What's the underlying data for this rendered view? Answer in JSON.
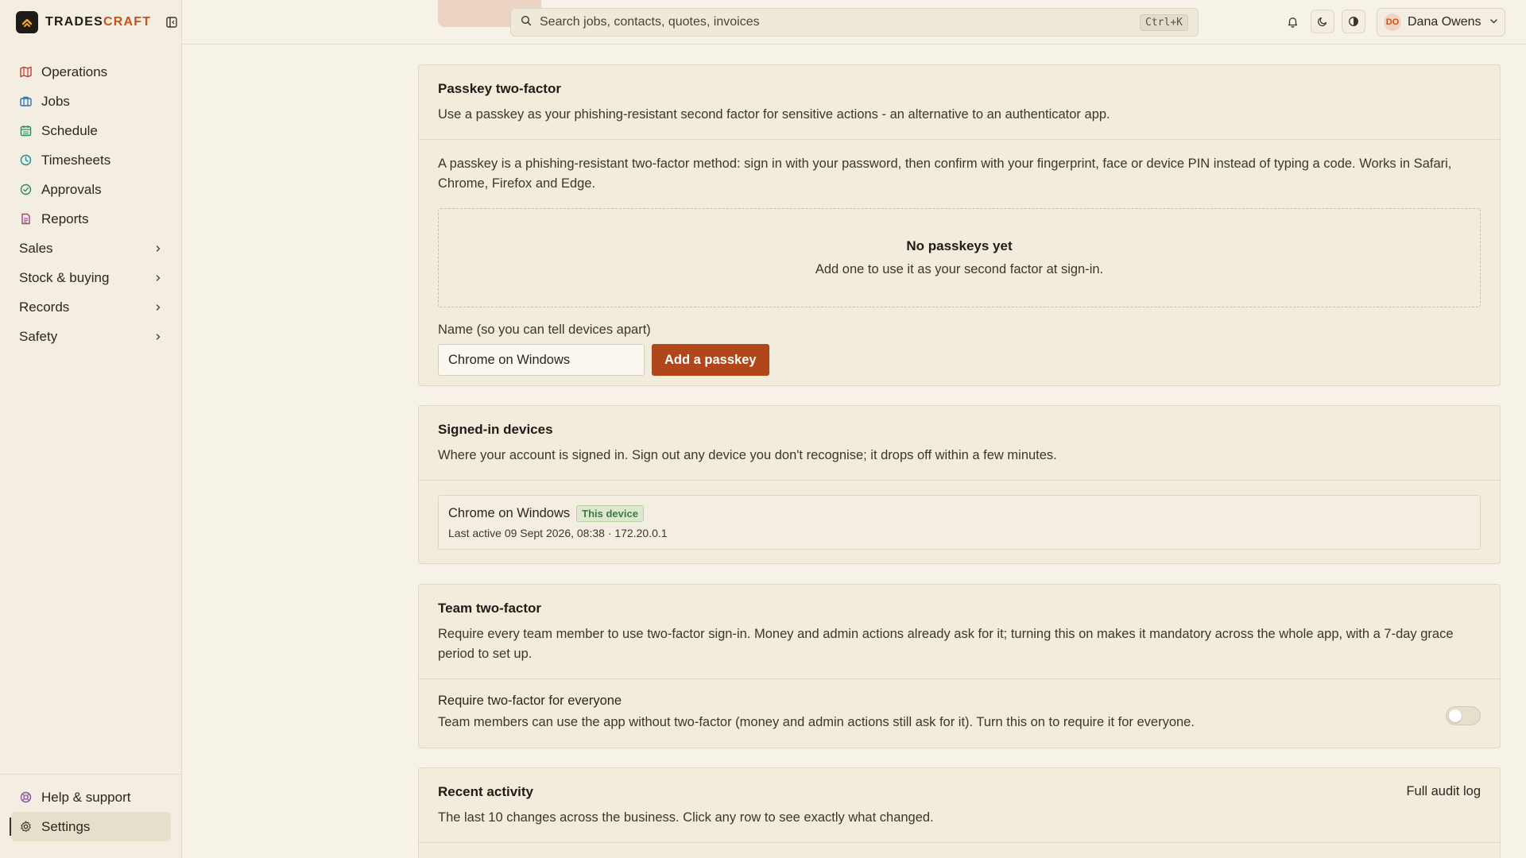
{
  "brand": {
    "name_main": "TRADES",
    "name_accent": "CRAFT",
    "logo_icon": "chevron-up-icon"
  },
  "sidebar": {
    "items": [
      {
        "label": "Operations",
        "icon": "map-icon",
        "color": "#c0392b"
      },
      {
        "label": "Jobs",
        "icon": "briefcase-icon",
        "color": "#2f6fb3"
      },
      {
        "label": "Schedule",
        "icon": "calendar-icon",
        "color": "#2e8b57"
      },
      {
        "label": "Timesheets",
        "icon": "clock-icon",
        "color": "#1f8a9a"
      },
      {
        "label": "Approvals",
        "icon": "check-circle-icon",
        "color": "#2e8b57"
      },
      {
        "label": "Reports",
        "icon": "file-text-icon",
        "color": "#a03c8c"
      }
    ],
    "groups": [
      {
        "label": "Sales"
      },
      {
        "label": "Stock & buying"
      },
      {
        "label": "Records"
      },
      {
        "label": "Safety"
      }
    ],
    "bottom": [
      {
        "label": "Help & support",
        "icon": "life-buoy-icon",
        "color": "#8a4fa8"
      },
      {
        "label": "Settings",
        "icon": "gear-icon",
        "color": "#3a342b"
      }
    ]
  },
  "header": {
    "search_placeholder": "Search jobs, contacts, quotes, invoices",
    "search_shortcut": "Ctrl+K",
    "user_initials": "DO",
    "user_name": "Dana Owens"
  },
  "passkey": {
    "title": "Passkey two-factor",
    "description": "Use a passkey as your phishing-resistant second factor for sensitive actions - an alternative to an authenticator app.",
    "body": "A passkey is a phishing-resistant two-factor method: sign in with your password, then confirm with your fingerprint, face or device PIN instead of typing a code. Works in Safari, Chrome, Firefox and Edge.",
    "empty_title": "No passkeys yet",
    "empty_sub": "Add one to use it as your second factor at sign-in.",
    "name_label": "Name (so you can tell devices apart)",
    "name_value": "Chrome on Windows",
    "add_button": "Add a passkey"
  },
  "devices": {
    "title": "Signed-in devices",
    "description": "Where your account is signed in. Sign out any device you don't recognise; it drops off within a few minutes.",
    "items": [
      {
        "name": "Chrome on Windows",
        "badge": "This device",
        "meta": "Last active 09 Sept 2026, 08:38 · 172.20.0.1"
      }
    ]
  },
  "team2fa": {
    "title": "Team two-factor",
    "description": "Require every team member to use two-factor sign-in. Money and admin actions already ask for it; turning this on makes it mandatory across the whole app, with a 7-day grace period to set up.",
    "setting_title": "Require two-factor for everyone",
    "setting_desc": "Team members can use the app without two-factor (money and admin actions still ask for it). Turn this on to require it for everyone.",
    "enabled": false
  },
  "activity": {
    "title": "Recent activity",
    "description": "The last 10 changes across the business. Click any row to see exactly what changed.",
    "link": "Full audit log"
  },
  "colors": {
    "accent": "#b0461a",
    "background": "#f7f2e7",
    "card": "#f2ecdd"
  }
}
